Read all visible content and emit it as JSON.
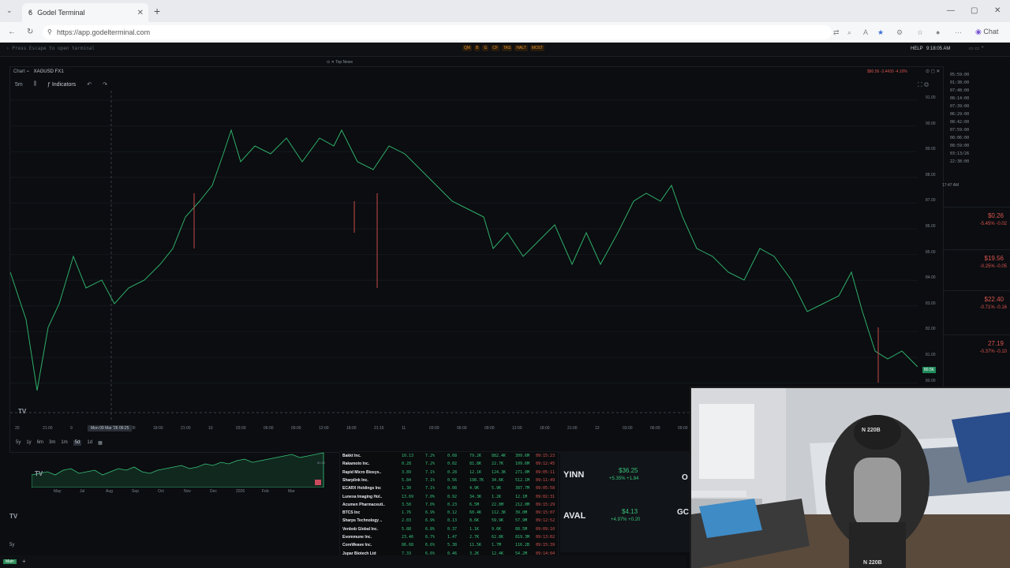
{
  "browser": {
    "tab_title": "Godel Terminal",
    "tab_close": "✕",
    "new_tab": "+",
    "url": "https://app.godelterminal.com",
    "chat_label": "Chat"
  },
  "terminal": {
    "escape_hint": "Press Escape to open terminal",
    "fn_keys": [
      "QM",
      "B",
      "G",
      "CF",
      "TAS",
      "HALT",
      "MOST"
    ],
    "help": "HELP",
    "clock": "9:18:05 AM",
    "top_news": "Top News"
  },
  "chart": {
    "label": "Chart",
    "symbol": "XAGUSD FX1",
    "quote": "$80.56 -3.4430 -4.10%",
    "interval": "5m",
    "indicators": "Indicators",
    "price_ticks": [
      "91.00",
      "90.00",
      "89.00",
      "88.00",
      "87.00",
      "86.00",
      "85.00",
      "84.00",
      "83.00",
      "82.00",
      "81.00",
      "80.00"
    ],
    "last_price": "80.56",
    "time_ticks": [
      "20",
      "21:00",
      "9",
      "03:00",
      "12:00",
      "18:00",
      "21:00",
      "10",
      "03:00",
      "06:00",
      "09:00",
      "12:00",
      "18:00",
      "21:15",
      "11",
      "03:00",
      "06:00",
      "09:00",
      "12:00",
      "18:00",
      "21:00",
      "12",
      "03:00",
      "06:00",
      "09:00"
    ],
    "crosshair_time": "Mon 09 Mar '26  06:25"
  },
  "mini_chart": {
    "ranges": [
      "5y",
      "1y",
      "6m",
      "3m",
      "1m",
      "5d",
      "1d"
    ],
    "selected_range": "5d",
    "months": [
      "May",
      "Jul",
      "Aug",
      "Sep",
      "Oct",
      "Nov",
      "Dec",
      "2026",
      "Feb",
      "Mar"
    ],
    "pct": "60.00"
  },
  "screener": {
    "rows": [
      {
        "name": "Bakkt Inc.",
        "vals": [
          "10.13",
          "7.2%",
          "0.68",
          "79.2K",
          "882.4K",
          "309.6M",
          "09:15:23"
        ]
      },
      {
        "name": "Rakamoto Inc.",
        "vals": [
          "0.28",
          "7.2%",
          "0.02",
          "81.8K",
          "22.7K",
          "109.6M",
          "09:12:45"
        ]
      },
      {
        "name": "Rapid Micro Biosys..",
        "vals": [
          "3.89",
          "7.1%",
          "0.28",
          "12.1K",
          "124.3K",
          "271.0M",
          "09:05:11"
        ]
      },
      {
        "name": "Sharplink Inc.",
        "vals": [
          "5.84",
          "7.1%",
          "0.56",
          "198.7K",
          "34.6K",
          "512.1M",
          "09:11:49"
        ]
      },
      {
        "name": "ECARX Holdings Inc",
        "vals": [
          "1.30",
          "7.1%",
          "0.08",
          "4.9K",
          "5.9K",
          "387.7M",
          "09:05:58"
        ]
      },
      {
        "name": "Lunexa Imaging Hol..",
        "vals": [
          "13.69",
          "7.0%",
          "0.92",
          "34.3K",
          "1.2K",
          "12.1M",
          "09:02:31"
        ]
      },
      {
        "name": "Acumen Pharmaceuti..",
        "vals": [
          "3.50",
          "7.0%",
          "0.23",
          "6.5M",
          "22.8M",
          "212.0M",
          "09:15:29"
        ]
      },
      {
        "name": "BTCS Inc",
        "vals": [
          "1.76",
          "6.9%",
          "0.12",
          "60.4K",
          "112.3K",
          "39.0M",
          "09:15:07"
        ]
      },
      {
        "name": "Sharps Technology ..",
        "vals": [
          "2.03",
          "6.9%",
          "0.13",
          "8.6K",
          "59.9K",
          "57.9M",
          "09:12:52"
        ]
      },
      {
        "name": "Venbob Global Inc.",
        "vals": [
          "5.88",
          "6.8%",
          "0.37",
          "1.1K",
          "9.6K",
          "88.5M",
          "09:09:10"
        ]
      },
      {
        "name": "Evommune Inc.",
        "vals": [
          "23.46",
          "6.7%",
          "1.47",
          "2.7K",
          "62.8K",
          "819.3M",
          "09:13:02"
        ]
      },
      {
        "name": "CoreWeave Inc.",
        "vals": [
          "86.68",
          "6.6%",
          "5.38",
          "11.5K",
          "1.7M",
          "116.2B",
          "09:15:39"
        ]
      },
      {
        "name": "Jupar Biotech Ltd",
        "vals": [
          "7.33",
          "6.6%",
          "0.46",
          "3.2K",
          "12.4K",
          "54.2M",
          "09:14:04"
        ]
      }
    ]
  },
  "tickers": [
    {
      "symbol": "YINN",
      "price": "$36.25",
      "change": "+5.35% +1.84"
    },
    {
      "symbol": "AVAL",
      "price": "$4.13",
      "change": "+4.97% +0.20"
    }
  ],
  "ticker_partials": [
    "O",
    "GC"
  ],
  "right_panel": {
    "times": [
      "05:59:00",
      "01:38:00",
      "07:48:00",
      "08:14:00",
      "07:39:00",
      "06:29:00",
      "08:42:00",
      "07:59:00",
      "08:06:00",
      "08:59:00",
      "03:13/26",
      "22:38:00"
    ],
    "clock": "17:47 AM",
    "watchlist": [
      {
        "price": "$0.26",
        "change": "-5.45% -0.02"
      },
      {
        "price": "$19.56",
        "change": "-0.25% -0.05"
      },
      {
        "price": "$22.40",
        "change": "-0.71% -0.16"
      },
      {
        "price": "27.19",
        "change": "-0.37% -0.10"
      }
    ]
  },
  "bottom": {
    "badge": "Main"
  },
  "webcam": {
    "chair_logo": "N 220B",
    "chair_logo_bottom": "N 220B"
  },
  "colors": {
    "up": "#37c27a",
    "down": "#d9544f",
    "accent": "#e08f2a"
  }
}
